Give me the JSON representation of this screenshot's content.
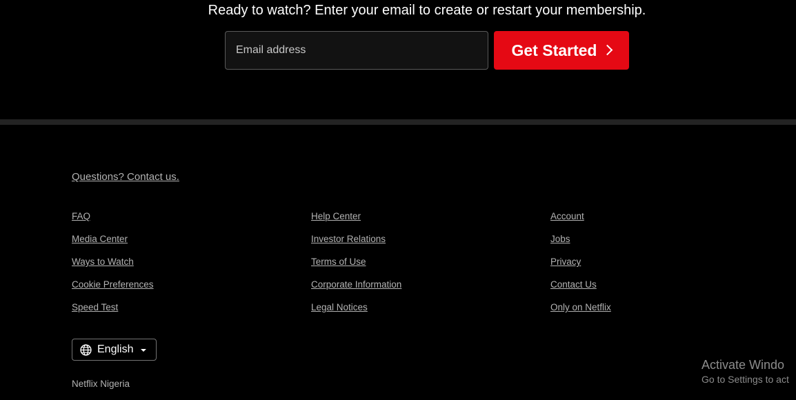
{
  "cta": {
    "heading": "Ready to watch? Enter your email to create or restart your membership.",
    "email_placeholder": "Email address",
    "email_value": "",
    "button_label": "Get Started"
  },
  "footer": {
    "questions_link": "Questions? Contact us.",
    "columns": [
      [
        "FAQ",
        "Media Center",
        "Ways to Watch",
        "Cookie Preferences",
        "Speed Test"
      ],
      [
        "Help Center",
        "Investor Relations",
        "Terms of Use",
        "Corporate Information",
        "Legal Notices"
      ],
      [
        "Account",
        "Jobs",
        "Privacy",
        "Contact Us",
        "Only on Netflix"
      ]
    ],
    "language": "English",
    "country": "Netflix Nigeria"
  },
  "watermark": {
    "line1": "Activate Windo",
    "line2": "Go to Settings to act"
  },
  "colors": {
    "background": "#000000",
    "accent": "#e50914",
    "link": "#b3b3b3"
  }
}
